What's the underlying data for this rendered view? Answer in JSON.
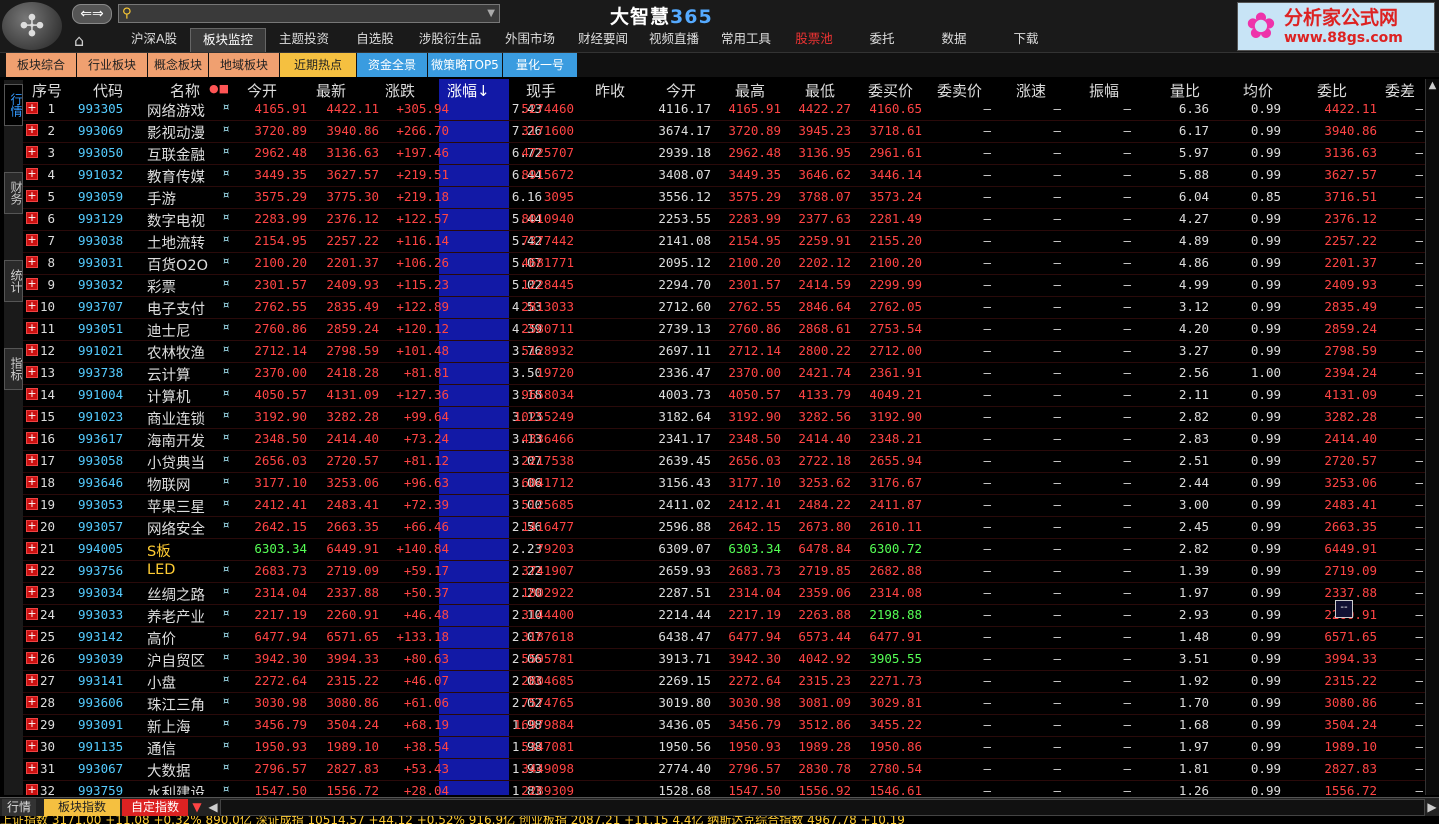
{
  "app": {
    "title_cn": "大智慧",
    "title_num": "365",
    "back_fwd": "⇐⇒",
    "search_value": "",
    "brand_line1": "分析家公式网",
    "brand_line2": "www.88gs.com"
  },
  "menu": [
    "沪深A股",
    "板块监控",
    "主题投资",
    "自选股",
    "涉股衍生品",
    "外围市场",
    "财经要闻",
    "视频直播",
    "常用工具",
    "股票池",
    "委托",
    "数据",
    "下载"
  ],
  "subtabs": [
    {
      "label": "板块综合",
      "bg": "#f0a070"
    },
    {
      "label": "行业板块",
      "bg": "#f0a070"
    },
    {
      "label": "概念板块",
      "bg": "#f0a070"
    },
    {
      "label": "地域板块",
      "bg": "#f0a070"
    },
    {
      "label": "近期热点",
      "bg": "#f5c040"
    },
    {
      "label": "资金全景",
      "bg": "#3a9ce0"
    },
    {
      "label": "微策略TOP5",
      "bg": "#3a9ce0"
    },
    {
      "label": "量化一号",
      "bg": "#3a9ce0"
    }
  ],
  "lefttabs": [
    "行情",
    "财务",
    "统计",
    "指标"
  ],
  "columns": [
    "序号",
    "代码",
    "名称",
    "今开",
    "最新",
    "涨跌",
    "涨幅↓",
    "现手",
    "昨收",
    "今开",
    "最高",
    "最低",
    "委买价",
    "委卖价",
    "涨速",
    "振幅",
    "量比",
    "均价",
    "委比",
    "委差"
  ],
  "name_marker": "●■",
  "rows": [
    [
      "1",
      "993305",
      "网络游戏",
      "¤",
      "4165.91",
      "4422.11",
      "+305.94",
      "7.43",
      "5274460",
      "4116.17",
      "4165.91",
      "4422.27",
      "4160.65",
      "–",
      "–",
      "–",
      "6.36",
      "0.99",
      "4422.11",
      "–"
    ],
    [
      "2",
      "993069",
      "影视动漫",
      "¤",
      "3720.89",
      "3940.86",
      "+266.70",
      "7.26",
      "3171600",
      "3674.17",
      "3720.89",
      "3945.23",
      "3718.61",
      "–",
      "–",
      "–",
      "6.17",
      "0.99",
      "3940.86",
      "–"
    ],
    [
      "3",
      "993050",
      "互联金融",
      "¤",
      "2962.48",
      "3136.63",
      "+197.46",
      "6.72",
      "4725707",
      "2939.18",
      "2962.48",
      "3136.95",
      "2961.61",
      "–",
      "–",
      "–",
      "5.97",
      "0.99",
      "3136.63",
      "–"
    ],
    [
      "4",
      "991032",
      "教育传媒",
      "¤",
      "3449.35",
      "3627.57",
      "+219.51",
      "6.44",
      "8915672",
      "3408.07",
      "3449.35",
      "3646.62",
      "3446.14",
      "–",
      "–",
      "–",
      "5.88",
      "0.99",
      "3627.57",
      "–"
    ],
    [
      "5",
      "993059",
      "手游",
      "¤",
      "3575.29",
      "3775.30",
      "+219.18",
      "6.16",
      "3095",
      "3556.12",
      "3575.29",
      "3788.07",
      "3573.24",
      "–",
      "–",
      "–",
      "6.04",
      "0.85",
      "3716.51",
      "–"
    ],
    [
      "6",
      "993129",
      "数字电视",
      "¤",
      "2283.99",
      "2376.12",
      "+122.57",
      "5.44",
      "8010940",
      "2253.55",
      "2283.99",
      "2377.63",
      "2281.49",
      "–",
      "–",
      "–",
      "4.27",
      "0.99",
      "2376.12",
      "–"
    ],
    [
      "7",
      "993038",
      "土地流转",
      "¤",
      "2154.95",
      "2257.22",
      "+116.14",
      "5.42",
      "7377442",
      "2141.08",
      "2154.95",
      "2259.91",
      "2155.20",
      "–",
      "–",
      "–",
      "4.89",
      "0.99",
      "2257.22",
      "–"
    ],
    [
      "8",
      "993031",
      "百货O2O",
      "¤",
      "2100.20",
      "2201.37",
      "+106.26",
      "5.07",
      "4681771",
      "2095.12",
      "2100.20",
      "2202.12",
      "2100.20",
      "–",
      "–",
      "–",
      "4.86",
      "0.99",
      "2201.37",
      "–"
    ],
    [
      "9",
      "993032",
      "彩票",
      "¤",
      "2301.57",
      "2409.93",
      "+115.23",
      "5.02",
      "1228445",
      "2294.70",
      "2301.57",
      "2414.59",
      "2299.99",
      "–",
      "–",
      "–",
      "4.99",
      "0.99",
      "2409.93",
      "–"
    ],
    [
      "10",
      "993707",
      "电子支付",
      "¤",
      "2762.55",
      "2835.49",
      "+122.89",
      "4.53",
      "2813033",
      "2712.60",
      "2762.55",
      "2846.64",
      "2762.05",
      "–",
      "–",
      "–",
      "3.12",
      "0.99",
      "2835.49",
      "–"
    ],
    [
      "11",
      "993051",
      "迪士尼",
      "¤",
      "2760.86",
      "2859.24",
      "+120.12",
      "4.39",
      "2580711",
      "2739.13",
      "2760.86",
      "2868.61",
      "2753.54",
      "–",
      "–",
      "–",
      "4.20",
      "0.99",
      "2859.24",
      "–"
    ],
    [
      "12",
      "991021",
      "农林牧渔",
      "¤",
      "2712.14",
      "2798.59",
      "+101.48",
      "3.76",
      "5128932",
      "2697.11",
      "2712.14",
      "2800.22",
      "2712.00",
      "–",
      "–",
      "–",
      "3.27",
      "0.99",
      "2798.59",
      "–"
    ],
    [
      "13",
      "993738",
      "云计算",
      "¤",
      "2370.00",
      "2418.28",
      "+81.81",
      "3.50",
      "19720",
      "2336.47",
      "2370.00",
      "2421.74",
      "2361.91",
      "–",
      "–",
      "–",
      "2.56",
      "1.00",
      "2394.24",
      "–"
    ],
    [
      "14",
      "991004",
      "计算机",
      "¤",
      "4050.57",
      "4131.09",
      "+127.36",
      "3.18",
      "9658034",
      "4003.73",
      "4050.57",
      "4133.79",
      "4049.21",
      "–",
      "–",
      "–",
      "2.11",
      "0.99",
      "4131.09",
      "–"
    ],
    [
      "15",
      "991023",
      "商业连锁",
      "¤",
      "3192.90",
      "3282.28",
      "+99.64",
      "3.13",
      "10255249",
      "3182.64",
      "3192.90",
      "3282.56",
      "3192.90",
      "–",
      "–",
      "–",
      "2.82",
      "0.99",
      "3282.28",
      "–"
    ],
    [
      "16",
      "993617",
      "海南开发",
      "¤",
      "2348.50",
      "2414.40",
      "+73.24",
      "3.13",
      "4336466",
      "2341.17",
      "2348.50",
      "2414.40",
      "2348.21",
      "–",
      "–",
      "–",
      "2.83",
      "0.99",
      "2414.40",
      "–"
    ],
    [
      "17",
      "993058",
      "小贷典当",
      "¤",
      "2656.03",
      "2720.57",
      "+81.12",
      "3.07",
      "2217538",
      "2639.45",
      "2656.03",
      "2722.18",
      "2655.94",
      "–",
      "–",
      "–",
      "2.51",
      "0.99",
      "2720.57",
      "–"
    ],
    [
      "18",
      "993646",
      "物联网",
      "¤",
      "3177.10",
      "3253.06",
      "+96.63",
      "3.06",
      "6041712",
      "3156.43",
      "3177.10",
      "3253.62",
      "3176.67",
      "–",
      "–",
      "–",
      "2.44",
      "0.99",
      "3253.06",
      "–"
    ],
    [
      "19",
      "993053",
      "苹果三星",
      "¤",
      "2412.41",
      "2483.41",
      "+72.39",
      "3.00",
      "5125685",
      "2411.02",
      "2412.41",
      "2484.22",
      "2411.87",
      "–",
      "–",
      "–",
      "3.00",
      "0.99",
      "2483.41",
      "–"
    ],
    [
      "20",
      "993057",
      "网络安全",
      "¤",
      "2642.15",
      "2663.35",
      "+66.46",
      "2.56",
      "1416477",
      "2596.88",
      "2642.15",
      "2673.80",
      "2610.11",
      "–",
      "–",
      "–",
      "2.45",
      "0.99",
      "2663.35",
      "–"
    ],
    [
      "21",
      "994005",
      "S板",
      "",
      "6303.34",
      "6449.91",
      "+140.84",
      "2.23",
      "79203",
      "6309.07",
      "6303.34",
      "6478.84",
      "6300.72",
      "–",
      "–",
      "–",
      "2.82",
      "0.99",
      "6449.91",
      "–"
    ],
    [
      "22",
      "993756",
      "LED",
      "¤",
      "2683.73",
      "2719.09",
      "+59.17",
      "2.22",
      "3741907",
      "2659.93",
      "2683.73",
      "2719.85",
      "2682.88",
      "–",
      "–",
      "–",
      "1.39",
      "0.99",
      "2719.09",
      "–"
    ],
    [
      "23",
      "993034",
      "丝绸之路",
      "¤",
      "2314.04",
      "2337.88",
      "+50.37",
      "2.20",
      "1802922",
      "2287.51",
      "2314.04",
      "2359.06",
      "2314.08",
      "–",
      "–",
      "–",
      "1.97",
      "0.99",
      "2337.88",
      "–"
    ],
    [
      "24",
      "993033",
      "养老产业",
      "¤",
      "2217.19",
      "2260.91",
      "+46.48",
      "2.10",
      "3144400",
      "2214.44",
      "2217.19",
      "2263.88",
      "2198.88",
      "–",
      "–",
      "–",
      "2.93",
      "0.99",
      "2260.91",
      "–"
    ],
    [
      "25",
      "993142",
      "高价",
      "¤",
      "6477.94",
      "6571.65",
      "+133.18",
      "2.07",
      "3187618",
      "6438.47",
      "6477.94",
      "6573.44",
      "6477.91",
      "–",
      "–",
      "–",
      "1.48",
      "0.99",
      "6571.65",
      "–"
    ],
    [
      "26",
      "993039",
      "沪自贸区",
      "¤",
      "3942.30",
      "3994.33",
      "+80.63",
      "2.06",
      "5595781",
      "3913.71",
      "3942.30",
      "4042.92",
      "3905.55",
      "–",
      "–",
      "–",
      "3.51",
      "0.99",
      "3994.33",
      "–"
    ],
    [
      "27",
      "993141",
      "小盘",
      "¤",
      "2272.64",
      "2315.22",
      "+46.07",
      "2.03",
      "2804685",
      "2269.15",
      "2272.64",
      "2315.23",
      "2271.73",
      "–",
      "–",
      "–",
      "1.92",
      "0.99",
      "2315.22",
      "–"
    ],
    [
      "28",
      "993606",
      "珠江三角",
      "¤",
      "3030.98",
      "3080.86",
      "+61.06",
      "2.02",
      "7574765",
      "3019.80",
      "3030.98",
      "3081.09",
      "3029.81",
      "–",
      "–",
      "–",
      "1.70",
      "0.99",
      "3080.86",
      "–"
    ],
    [
      "29",
      "993091",
      "新上海",
      "¤",
      "3456.79",
      "3504.24",
      "+68.19",
      "1.98",
      "16979884",
      "3436.05",
      "3456.79",
      "3512.86",
      "3455.22",
      "–",
      "–",
      "–",
      "1.68",
      "0.99",
      "3504.24",
      "–"
    ],
    [
      "30",
      "991135",
      "通信",
      "¤",
      "1950.93",
      "1989.10",
      "+38.54",
      "1.98",
      "5347081",
      "1950.56",
      "1950.93",
      "1989.28",
      "1950.86",
      "–",
      "–",
      "–",
      "1.97",
      "0.99",
      "1989.10",
      "–"
    ],
    [
      "31",
      "993067",
      "大数据",
      "¤",
      "2796.57",
      "2827.83",
      "+53.43",
      "1.93",
      "3449098",
      "2774.40",
      "2796.57",
      "2830.78",
      "2780.54",
      "–",
      "–",
      "–",
      "1.81",
      "0.99",
      "2827.83",
      "–"
    ],
    [
      "32",
      "993759",
      "水利建设",
      "¤",
      "1547.50",
      "1556.72",
      "+28.04",
      "1.83",
      "2289309",
      "1528.68",
      "1547.50",
      "1556.92",
      "1546.61",
      "–",
      "–",
      "–",
      "1.26",
      "0.99",
      "1556.72",
      "–"
    ]
  ],
  "green_cells": {
    "21": [
      4,
      10,
      12
    ],
    "24": [
      12
    ],
    "26": [
      12
    ]
  },
  "bottom": {
    "tab1": "行情",
    "tab2": "板块指数",
    "tab3": "自定指数",
    "ticker": "上证指数 3171.00 +11.08 +0.32%  890.0亿  深证成指 10514.57 +44.12 +0.52%  916.9亿  创业板指 2087.21 +11.15  4.4亿  纳斯达克综合指数 4967.78 +10.19"
  },
  "cursor_box": "--",
  "colors": {
    "red": "#ff4444",
    "green": "#55ff55",
    "yellow": "#ffcc33",
    "highlight_col": "#1219a6"
  }
}
